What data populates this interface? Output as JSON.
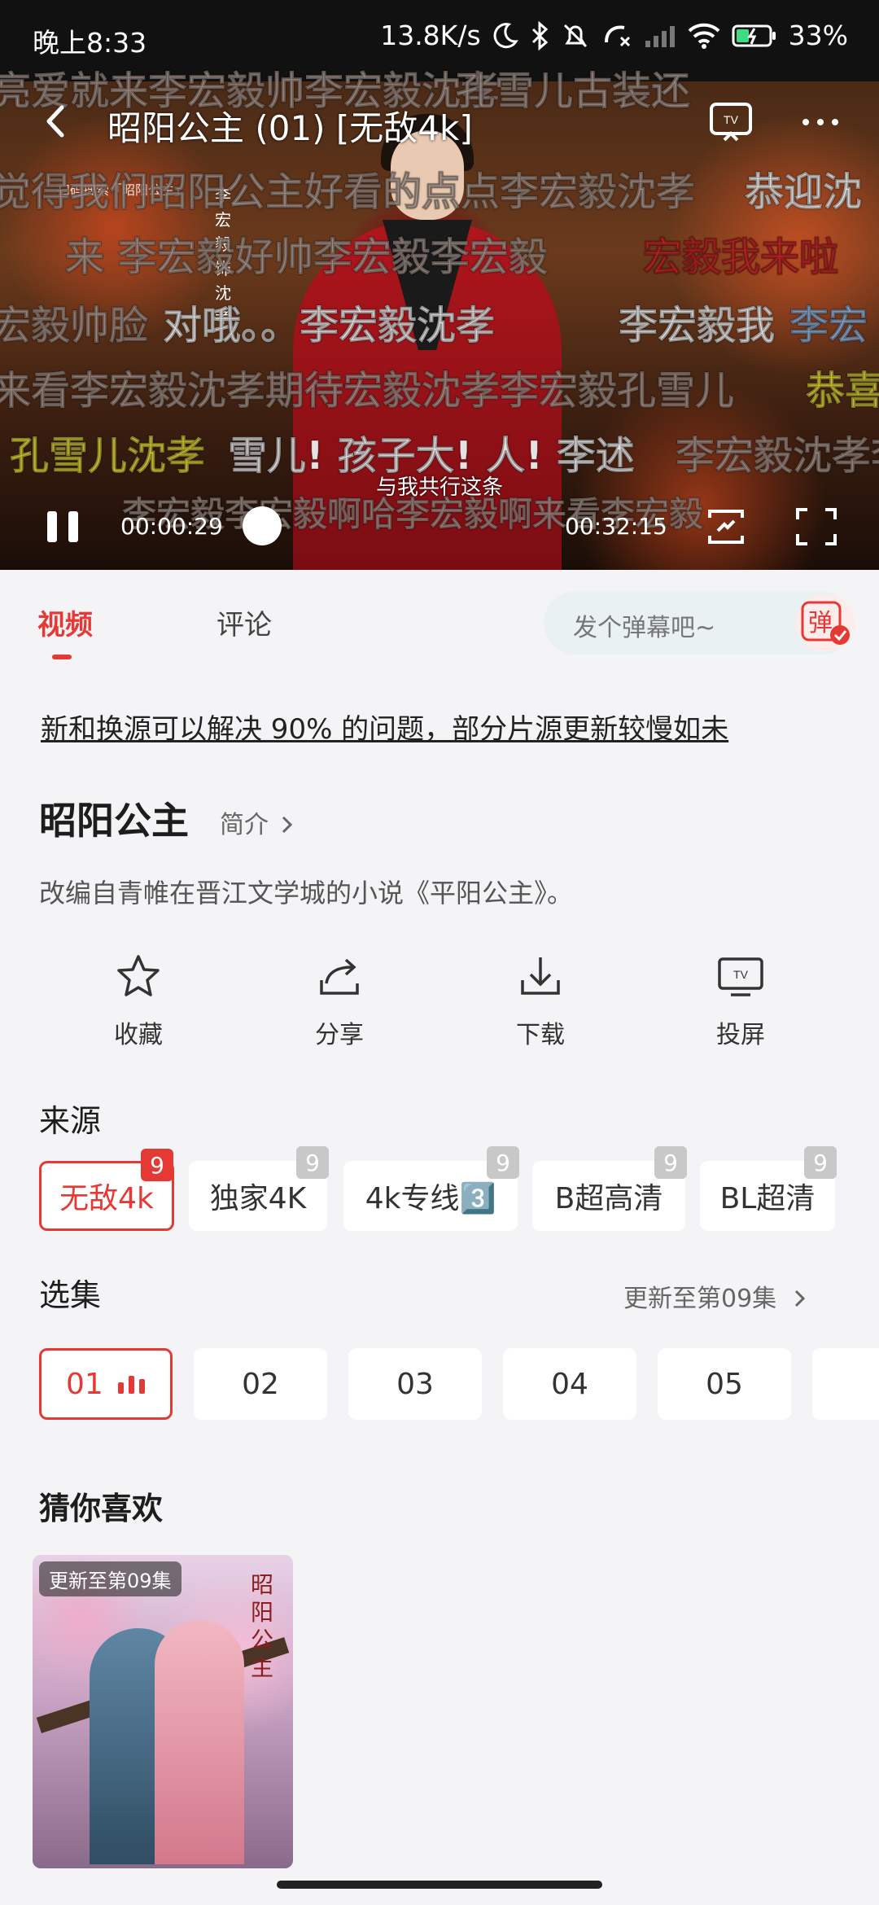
{
  "status_bar": {
    "time": "晚上8:33",
    "net_speed": "13.8K/s",
    "battery": "33%"
  },
  "player": {
    "title": "昭阳公主 (01) [无敌4k]",
    "current_time": "00:00:29",
    "total_time": "00:32:15",
    "progress": 0.015,
    "subtitle": "与我共行这条",
    "vertical_caption": "李宏毅饰沈孝",
    "watermark": "扫码搜索「昭阳公主」",
    "danmaku": [
      {
        "text": "亮爱就来李宏毅帅李宏毅沈孝",
        "color": "gray"
      },
      {
        "text": "孔雪儿古装还",
        "color": "gray"
      },
      {
        "text": "觉得我们昭阳公主好看的点点李宏毅沈孝",
        "color": "gray"
      },
      {
        "text": "恭迎沈",
        "color": "white"
      },
      {
        "text": "来 李宏毅好帅李宏毅李宏毅",
        "color": "gray"
      },
      {
        "text": "宏毅我来啦",
        "color": "red"
      },
      {
        "text": "宏毅帅脸",
        "color": "gray"
      },
      {
        "text": "对哦。。李宏毅沈孝",
        "color": "gray"
      },
      {
        "text": "李宏毅我",
        "color": "white"
      },
      {
        "text": "李宏",
        "color": "blue"
      },
      {
        "text": "来看李宏毅沈孝期待宏毅沈孝李宏毅孔雪儿",
        "color": "gray"
      },
      {
        "text": "恭喜",
        "color": "yellow"
      },
      {
        "text": "孔雪儿沈孝",
        "color": "yellow"
      },
      {
        "text": "雪儿! 孩子大! 人! 李述",
        "color": "white"
      },
      {
        "text": "李宏毅沈孝李",
        "color": "gray"
      },
      {
        "text": "李宏毅李宏毅啊哈李宏毅啊来看李宏毅",
        "color": "gray"
      }
    ]
  },
  "tabs": {
    "video": "视频",
    "comment": "评论"
  },
  "danmaku_input": {
    "placeholder": "发个弹幕吧~",
    "toggle_label": "弹"
  },
  "notice": "新和换源可以解决 90% 的问题，部分片源更新较慢如未",
  "show": {
    "title": "昭阳公主",
    "intro_label": "简介",
    "description": "改编自青帷在晋江文学城的小说《平阳公主》。"
  },
  "actions": [
    {
      "label": "收藏",
      "icon": "star-icon"
    },
    {
      "label": "分享",
      "icon": "share-icon"
    },
    {
      "label": "下载",
      "icon": "download-icon"
    },
    {
      "label": "投屏",
      "icon": "tv-icon"
    }
  ],
  "sources": {
    "title": "来源",
    "items": [
      {
        "label": "无敌4k",
        "badge": "9",
        "active": true
      },
      {
        "label": "独家4K",
        "badge": "9"
      },
      {
        "label": "4k专线3️⃣",
        "badge": "9"
      },
      {
        "label": "B超高清",
        "badge": "9"
      },
      {
        "label": "BL超清",
        "badge": "9"
      }
    ]
  },
  "episodes": {
    "title": "选集",
    "update_label": "更新至第09集",
    "items": [
      "01",
      "02",
      "03",
      "04",
      "05"
    ]
  },
  "recommend": {
    "title": "猜你喜欢",
    "card_badge": "更新至第09集",
    "card_poster_title": "昭阳公主"
  },
  "colors": {
    "accent": "#e53935",
    "background": "#f4f4f6"
  }
}
